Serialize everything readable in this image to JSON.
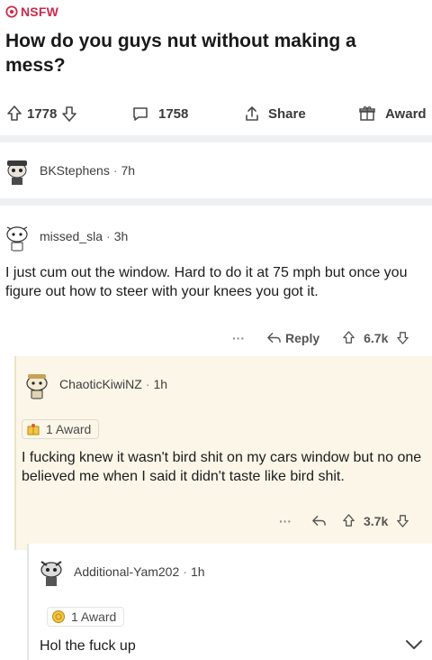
{
  "post": {
    "nsfw_label": "NSFW",
    "title": "How do you guys nut without making a mess?",
    "upvotes": "1778",
    "comments": "1758",
    "share_label": "Share",
    "award_label": "Award"
  },
  "comments": [
    {
      "username": "BKStephens",
      "age": "7h"
    },
    {
      "username": "missed_sla",
      "age": "3h",
      "body": "I just cum out the window. Hard to do it at 75 mph but once you figure out how to steer with your knees you got it.",
      "reply_label": "Reply",
      "votes": "6.7k"
    },
    {
      "username": "ChaoticKiwiNZ",
      "age": "1h",
      "award_text": "1 Award",
      "body": "I fucking knew it wasn't bird shit on my cars window but no one believed me when I said it didn't taste like bird shit.",
      "votes": "3.7k"
    },
    {
      "username": "Additional-Yam202",
      "age": "1h",
      "award_text": "1 Award",
      "body": "Hol the fuck up"
    }
  ],
  "colors": {
    "nsfw": "#d0284a",
    "nested_bg": "#fbf6e8",
    "divider": "#eef0f1"
  },
  "separator": "·",
  "ellipsis": "···"
}
